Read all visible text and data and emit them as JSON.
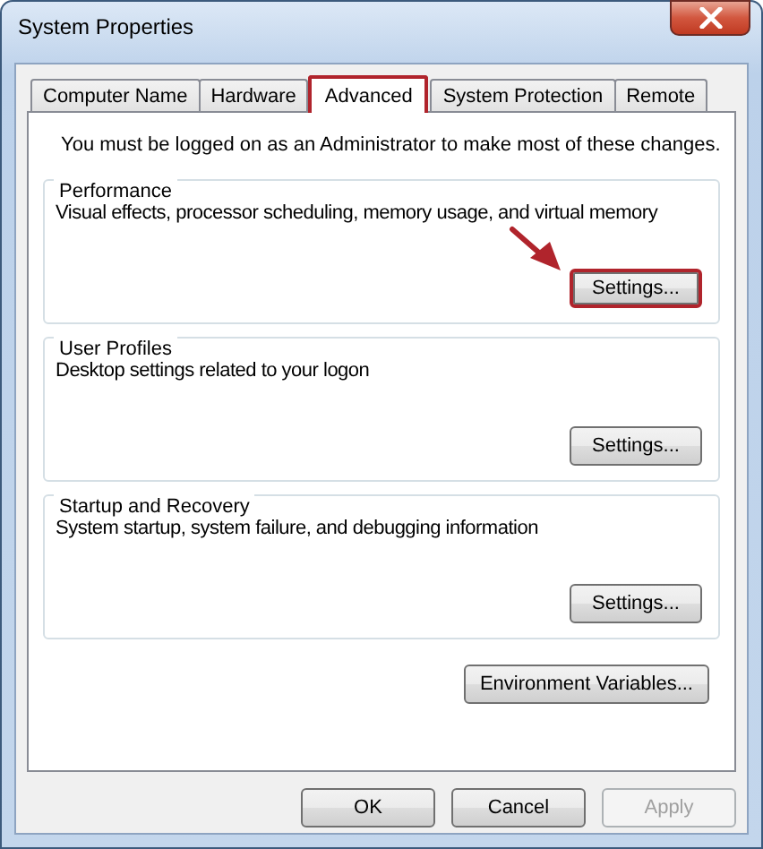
{
  "window": {
    "title": "System Properties"
  },
  "tabs": [
    {
      "label": "Computer Name",
      "selected": false,
      "highlighted": false
    },
    {
      "label": "Hardware",
      "selected": false,
      "highlighted": false
    },
    {
      "label": "Advanced",
      "selected": true,
      "highlighted": true
    },
    {
      "label": "System Protection",
      "selected": false,
      "highlighted": false
    },
    {
      "label": "Remote",
      "selected": false,
      "highlighted": false
    }
  ],
  "notice": "You must be logged on as an Administrator to make most of these changes.",
  "groups": [
    {
      "title": "Performance",
      "description": "Visual effects, processor scheduling, memory usage, and virtual memory",
      "button": {
        "label": "Settings...",
        "highlighted": true
      }
    },
    {
      "title": "User Profiles",
      "description": "Desktop settings related to your logon",
      "button": {
        "label": "Settings...",
        "highlighted": false
      }
    },
    {
      "title": "Startup and Recovery",
      "description": "System startup, system failure, and debugging information",
      "button": {
        "label": "Settings...",
        "highlighted": false
      }
    }
  ],
  "environment_button": {
    "label": "Environment Variables..."
  },
  "buttons": [
    {
      "label": "OK",
      "disabled": false
    },
    {
      "label": "Cancel",
      "disabled": false
    },
    {
      "label": "Apply",
      "disabled": true
    }
  ],
  "annotation": {
    "kind": "arrow"
  }
}
